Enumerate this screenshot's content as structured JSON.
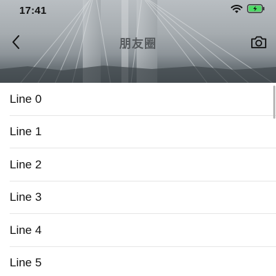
{
  "status_bar": {
    "time": "17:41",
    "wifi_icon": "wifi-icon",
    "battery_icon": "battery-charging-icon",
    "battery_color": "#4cd964"
  },
  "navbar": {
    "title": "朋友圈",
    "back_icon": "chevron-left-icon",
    "camera_icon": "camera-icon"
  },
  "list": {
    "items": [
      {
        "label": "Line 0"
      },
      {
        "label": "Line 1"
      },
      {
        "label": "Line 2"
      },
      {
        "label": "Line 3"
      },
      {
        "label": "Line 4"
      },
      {
        "label": "Line 5"
      }
    ]
  }
}
